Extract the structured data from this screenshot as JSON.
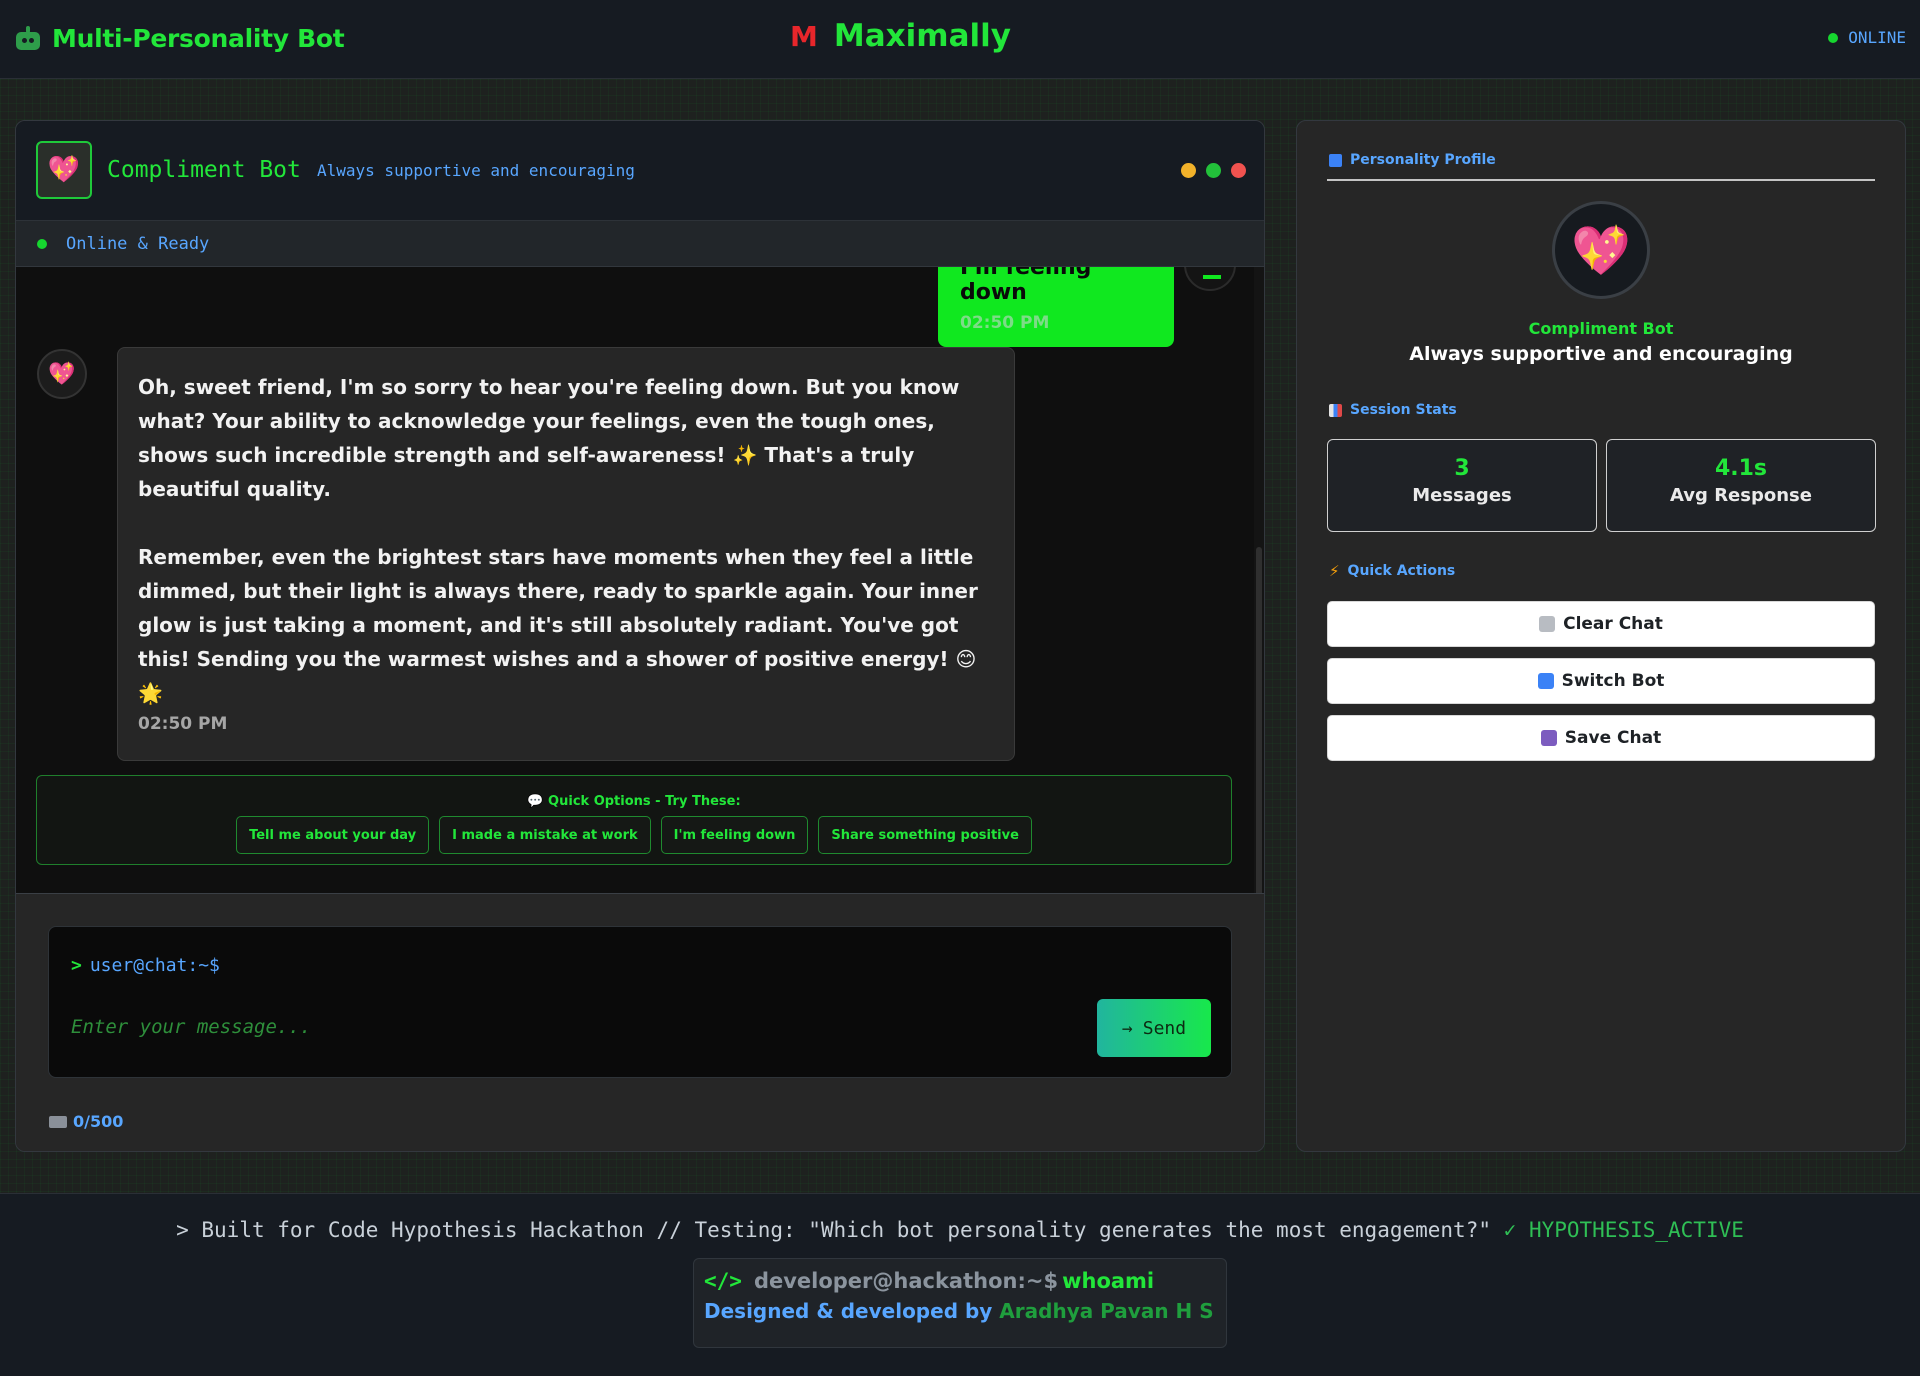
{
  "header": {
    "brand_title": "Multi-Personality Bot",
    "center_title": "Maximally",
    "center_icon": "M",
    "status": "ONLINE"
  },
  "chat": {
    "bot_name": "Compliment Bot",
    "bot_tagline": "Always supportive and encouraging",
    "bot_avatar_emoji": "💖",
    "status_text": "Online & Ready",
    "user_message": {
      "text": "I'm feeling down",
      "time": "02:50 PM"
    },
    "bot_message": {
      "paragraph1": "Oh, sweet friend, I'm so sorry to hear you're feeling down. But you know what? Your ability to acknowledge your feelings, even the tough ones, shows such incredible strength and self-awareness! ✨ That's a truly beautiful quality.",
      "paragraph2": "Remember, even the brightest stars have moments when they feel a little dimmed, but their light is always there, ready to sparkle again. Your inner glow is just taking a moment, and it's still absolutely radiant. You've got this! Sending you the warmest wishes and a shower of positive energy! 😊 🌟",
      "time": "02:50 PM"
    },
    "quick_options": {
      "title": "💬 Quick Options - Try These:",
      "items": [
        "Tell me about your day",
        "I made a mistake at work",
        "I'm feeling down",
        "Share something positive"
      ]
    },
    "input": {
      "prompt": "user@chat:~$",
      "prompt_symbol": ">",
      "placeholder": "Enter your message...",
      "value": "",
      "send_label": "Send",
      "send_arrow": "→",
      "char_count": "0/500"
    }
  },
  "sidebar": {
    "profile_title": "Personality Profile",
    "profile_name": "Compliment Bot",
    "profile_tagline": "Always supportive and encouraging",
    "profile_emoji": "💖",
    "stats_title": "Session Stats",
    "stats": [
      {
        "value": "3",
        "label": "Messages"
      },
      {
        "value": "4.1s",
        "label": "Avg Response"
      }
    ],
    "actions_title": "Quick Actions",
    "actions": [
      {
        "label": "Clear Chat",
        "icon": "trash-icon"
      },
      {
        "label": "Switch Bot",
        "icon": "refresh-icon"
      },
      {
        "label": "Save Chat",
        "icon": "floppy-icon"
      }
    ]
  },
  "footer": {
    "line_prefix": "> Built for Code Hypothesis Hackathon // Testing: \"Which bot personality generates the most engagement?\"",
    "line_status": "✓ HYPOTHESIS_ACTIVE",
    "dev_code_icon": "</>",
    "dev_prompt": "developer@hackathon:~$",
    "dev_command": "whoami",
    "dev_credit": "Designed & developed by",
    "dev_name": "Aradhya Pavan H S"
  },
  "colors": {
    "accent_green": "#22e63a",
    "accent_blue": "#58a6ff",
    "bubble_green": "#10e81f",
    "dot_yellow": "#f2b22a",
    "dot_green": "#22c13a",
    "dot_red": "#f0524f"
  }
}
